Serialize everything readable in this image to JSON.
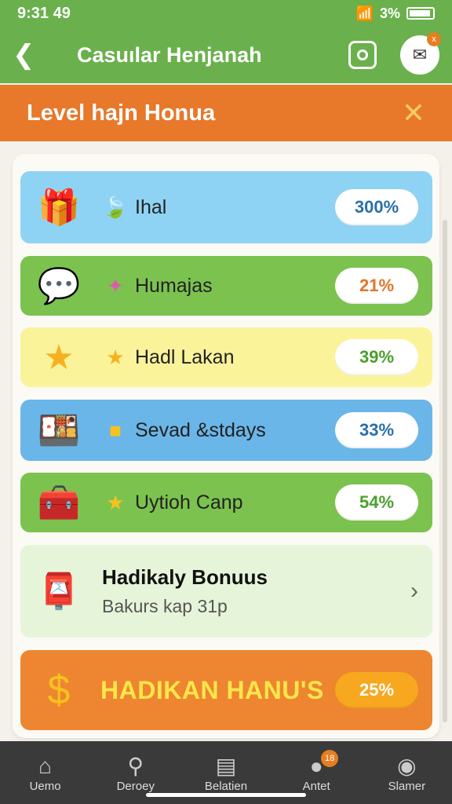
{
  "status": {
    "time": "9:31 49",
    "battery_text": "3%"
  },
  "app_bar": {
    "title": "Casuılar Henjanah"
  },
  "avatar_badge": "x",
  "banner": {
    "title": "Level hajn Honua",
    "close": "✕"
  },
  "rows": [
    {
      "label": "Ihal",
      "percent": "300%",
      "icon": "chest-icon",
      "small_icon": "leaf-icon",
      "color": "#8fd3f4",
      "pct_color": "#2b6fa8"
    },
    {
      "label": "Humajas",
      "percent": "21%",
      "icon": "chat-bubble-icon",
      "small_icon": "sparkle-icon",
      "color": "#7cc24f",
      "pct_color": "#e0762a"
    },
    {
      "label": "Hadl Lakan",
      "percent": "39%",
      "icon": "star-icon",
      "small_icon": "star-icon",
      "color": "#fbf39a",
      "pct_color": "#4aa02c"
    },
    {
      "label": "Sevad &stdays",
      "percent": "33%",
      "icon": "food-plate-icon",
      "small_icon": "cube-icon",
      "color": "#6ab6e8",
      "pct_color": "#2b6fa8"
    },
    {
      "label": "Uytioh Canp",
      "percent": "54%",
      "icon": "toolbox-icon",
      "small_icon": "star-icon",
      "color": "#7cc24f",
      "pct_color": "#4aa02c"
    }
  ],
  "bonus_row": {
    "title": "Hadikaly Bonuus",
    "subtitle": "Bakurs kap 31p"
  },
  "big_bonus": {
    "title": "HADIKAN HANU'S",
    "percent": "25%"
  },
  "nav": [
    {
      "label": "Uemo",
      "icon": "home-icon"
    },
    {
      "label": "Deroey",
      "icon": "search-icon"
    },
    {
      "label": "Belatien",
      "icon": "briefcase-icon"
    },
    {
      "label": "Antet",
      "icon": "chat-icon",
      "badge": "18"
    },
    {
      "label": "Slamer",
      "icon": "profile-icon"
    }
  ]
}
